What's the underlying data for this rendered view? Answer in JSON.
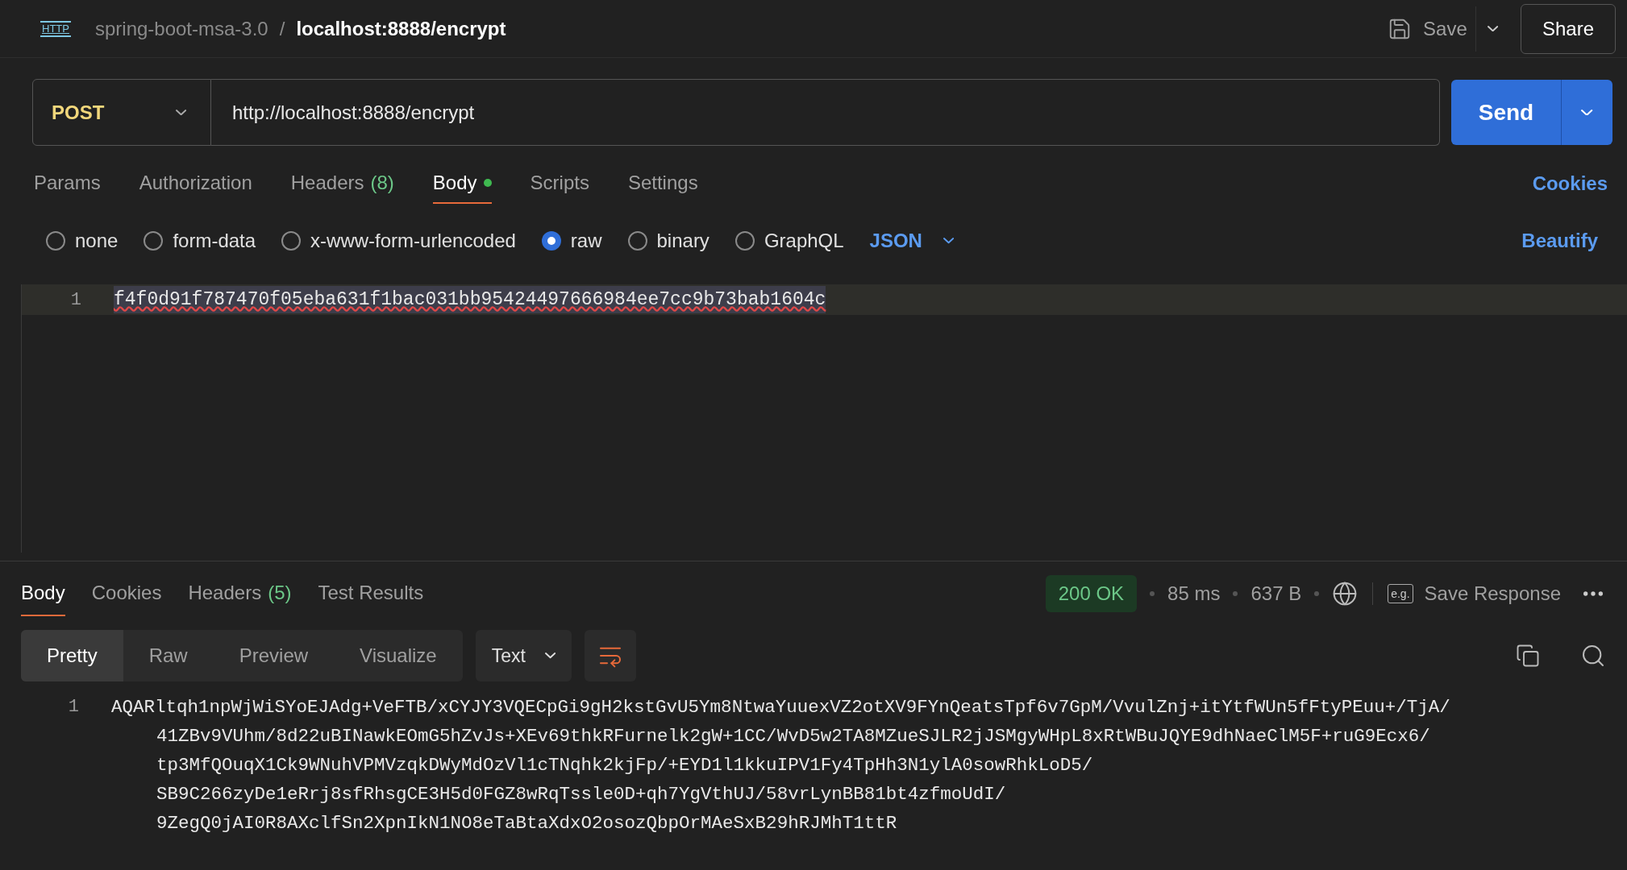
{
  "header": {
    "icon_label": "HTTP",
    "breadcrumb_parent": "spring-boot-msa-3.0",
    "separator": "/",
    "breadcrumb_current": "localhost:8888/encrypt",
    "save": "Save",
    "share": "Share"
  },
  "request": {
    "method": "POST",
    "url": "http://localhost:8888/encrypt",
    "send": "Send"
  },
  "request_tabs": [
    {
      "label": "Params",
      "selected": false,
      "has_content": false
    },
    {
      "label": "Authorization",
      "selected": false,
      "has_content": false
    },
    {
      "label": "Headers",
      "count": "(8)",
      "selected": false,
      "has_content": false
    },
    {
      "label": "Body",
      "selected": true,
      "has_content": true
    },
    {
      "label": "Scripts",
      "selected": false,
      "has_content": false
    },
    {
      "label": "Settings",
      "selected": false,
      "has_content": false
    }
  ],
  "cookies_link": "Cookies",
  "body_types": [
    {
      "label": "none",
      "selected": false
    },
    {
      "label": "form-data",
      "selected": false
    },
    {
      "label": "x-www-form-urlencoded",
      "selected": false
    },
    {
      "label": "raw",
      "selected": true
    },
    {
      "label": "binary",
      "selected": false
    },
    {
      "label": "GraphQL",
      "selected": false
    }
  ],
  "format": "JSON",
  "beautify": "Beautify",
  "editor": {
    "lines": [
      {
        "number": "1",
        "text": "f4f0d91f787470f05eba631f1bac031bb95424497666984ee7cc9b73bab1604c",
        "selected": true
      }
    ]
  },
  "response_tabs": [
    {
      "label": "Body",
      "selected": true
    },
    {
      "label": "Cookies",
      "selected": false
    },
    {
      "label": "Headers",
      "count": "(5)",
      "selected": false
    },
    {
      "label": "Test Results",
      "selected": false
    }
  ],
  "status": {
    "code": "200 OK",
    "time": "85 ms",
    "size": "637 B",
    "example_icon": "e.g.",
    "save_response": "Save Response"
  },
  "view_modes": [
    {
      "label": "Pretty",
      "selected": true
    },
    {
      "label": "Raw",
      "selected": false
    },
    {
      "label": "Preview",
      "selected": false
    },
    {
      "label": "Visualize",
      "selected": false
    }
  ],
  "response_format": "Text",
  "response_lines": [
    {
      "number": "1",
      "wrapped": [
        "AQARltqh1npWjWiSYoEJAdg+VeFTB/xCYJY3VQECpGi9gH2kstGvU5Ym8NtwaYuuexVZ2otXV9FYnQeatsTpf6v7GpM/VvulZnj+itYtfWUn5fFtyPEuu+/TjA/",
        "41ZBv9VUhm/8d22uBINawkEOmG5hZvJs+XEv69thkRFurnelk2gW+1CC/WvD5w2TA8MZueSJLR2jJSMgyWHpL8xRtWBuJQYE9dhNaeClM5F+ruG9Ecx6/",
        "tp3MfQOuqX1Ck9WNuhVPMVzqkDWyMdOzVl1cTNqhk2kjFp/+EYD1l1kkuIPV1Fy4TpHh3N1ylA0sowRhkLoD5/",
        "SB9C266zyDe1eRrj8sfRhsgCE3H5d0FGZ8wRqTssle0D+qh7YgVthUJ/58vrLynBB81bt4zfmoUdI/",
        "9ZegQ0jAI0R8AXclfSn2XpnIkN1NO8eTaBtaXdxO2osozQbpOrMAeSxB29hRJMhT1ttR"
      ]
    }
  ]
}
